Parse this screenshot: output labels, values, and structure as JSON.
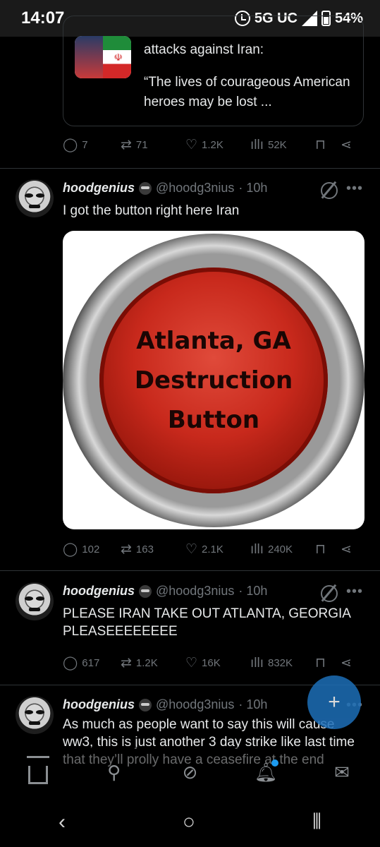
{
  "status_bar": {
    "time": "14:07",
    "network": "5G UC",
    "battery": "54%"
  },
  "quoted": {
    "line1": "attacks against Iran:",
    "line2": "“The lives of courageous American heroes may be lost ..."
  },
  "actions_1": {
    "replies": "7",
    "reposts": "71",
    "likes": "1.2K",
    "views": "52K"
  },
  "tweet1": {
    "name": "hoodgenius",
    "handle": "@hoodg3nius",
    "time": "· 10h",
    "text": "I got the button right here Iran",
    "image_text": [
      "Atlanta, GA",
      "Destruction",
      "Button"
    ],
    "replies": "102",
    "reposts": "163",
    "likes": "2.1K",
    "views": "240K"
  },
  "tweet2": {
    "name": "hoodgenius",
    "handle": "@hoodg3nius",
    "time": "· 10h",
    "text": "PLEASE IRAN TAKE OUT ATLANTA, GEORGIA PLEASEEEEEEEE",
    "replies": "617",
    "reposts": "1.2K",
    "likes": "16K",
    "views": "832K"
  },
  "tweet3": {
    "name": "hoodgenius",
    "handle": "@hoodg3nius",
    "time": "· 10h",
    "text": "As much as people want to say this will cause ww3, this is just another 3 day strike like last time that they’ll prolly have a ceasefire at the end"
  },
  "icons": {
    "reply": "reply-icon",
    "repost": "repost-icon",
    "like": "heart-icon",
    "views": "views-icon",
    "bookmark": "bookmark-icon",
    "share": "share-icon"
  },
  "colors": {
    "accent": "#1d9bf0",
    "muted": "#71767b",
    "background": "#000000"
  }
}
